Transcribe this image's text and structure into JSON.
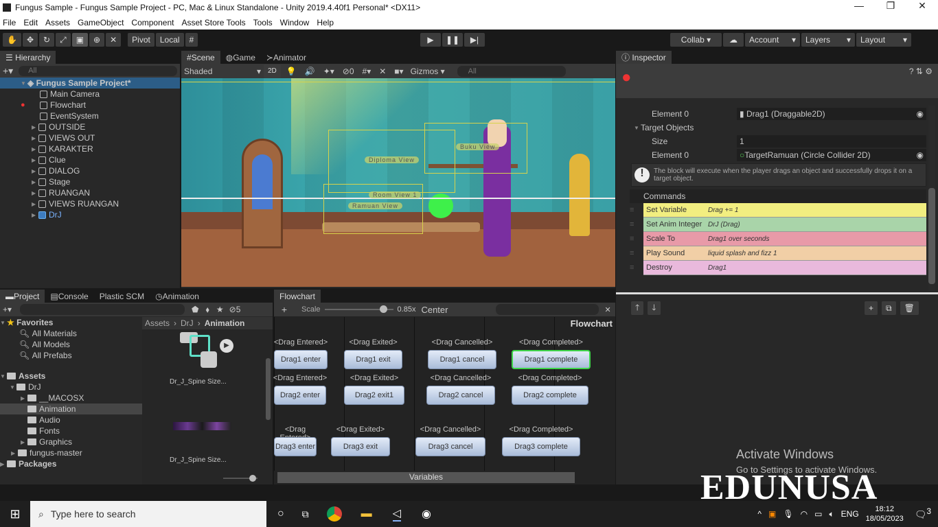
{
  "window": {
    "title": "Fungus Sample - Fungus Sample Project - PC, Mac & Linux Standalone - Unity 2019.4.40f1 Personal* <DX11>",
    "minimize": "—",
    "maximize": "❐",
    "close": "✕"
  },
  "menu": [
    "File",
    "Edit",
    "Assets",
    "GameObject",
    "Component",
    "Asset Store Tools",
    "Tools",
    "Window",
    "Help"
  ],
  "toolbar": {
    "pivot": "Pivot",
    "local": "Local",
    "collab": "Collab ▾",
    "account": "Account",
    "layers": "Layers",
    "layout": "Layout",
    "play": "▶",
    "pause": "❚❚",
    "step": "▶|"
  },
  "hierarchy": {
    "tab": "Hierarchy",
    "search_placeholder": "All",
    "root": "Fungus Sample Project*",
    "items": [
      "Main Camera",
      "Flowchart",
      "EventSystem",
      "OUTSIDE",
      "VIEWS OUT",
      "KARAKTER",
      "Clue",
      "DIALOG",
      "Stage",
      "RUANGAN",
      "VIEWS RUANGAN",
      "DrJ"
    ]
  },
  "scene": {
    "tabs": [
      "Scene",
      "Game",
      "Animator"
    ],
    "shading": "Shaded",
    "mode2d": "2D",
    "hidden_count": "0",
    "gizmos": "Gizmos",
    "search_placeholder": "All",
    "labels": [
      "Diploma View",
      "Buku View",
      "Room View 1",
      "Ramuan View"
    ]
  },
  "project": {
    "tabs": [
      "Project",
      "Console",
      "Plastic SCM",
      "Animation"
    ],
    "hidden_count": "5",
    "favorites": "Favorites",
    "fav_items": [
      "All Materials",
      "All Models",
      "All Prefabs"
    ],
    "assets": "Assets",
    "tree": [
      "DrJ",
      "__MACOSX",
      "Animation",
      "Audio",
      "Fonts",
      "Graphics",
      "fungus-master"
    ],
    "packages": "Packages",
    "breadcrumb": [
      "Assets",
      "DrJ",
      "Animation"
    ],
    "files": [
      "Dr_J_Spine Size...",
      "Dr_J_Spine Size..."
    ]
  },
  "flowchart": {
    "tab": "Flowchart",
    "scale_label": "Scale",
    "scale": "0.85x",
    "scale_value": 0.85,
    "center": "Center",
    "title": "Flowchart",
    "variables": "Variables",
    "events": [
      "<Drag Entered>",
      "<Drag Exited>",
      "<Drag Cancelled>",
      "<Drag Completed>"
    ],
    "blocks": [
      [
        "Drag1 enter",
        "Drag1 exit",
        "Drag1 cancel",
        "Drag1 complete"
      ],
      [
        "Drag2 enter",
        "Drag2 exit1",
        "Drag2 cancel",
        "Drag2 complete"
      ],
      [
        "Drag3 enter",
        "Drag3 exit",
        "Drag3 cancel",
        "Drag3 complete"
      ]
    ]
  },
  "inspector": {
    "tab": "Inspector",
    "element0_label": "Element 0",
    "element0_value": "Drag1 (Draggable2D)",
    "target_objects": "Target Objects",
    "size_label": "Size",
    "size_value": "1",
    "target_element_label": "Element 0",
    "target_element_value": "TargetRamuan (Circle Collider 2D)",
    "info": "The block will execute when the player drags an object and successfully drops it on a target object.",
    "commands_header": "Commands",
    "commands": [
      {
        "name": "Set Variable",
        "summary": "Drag += 1",
        "color": "#f2ee80"
      },
      {
        "name": "Set Anim Integer",
        "summary": "DrJ (Drag)",
        "color": "#a9d4a9"
      },
      {
        "name": "Scale To",
        "summary": "Drag1 over seconds",
        "color": "#e89aa8"
      },
      {
        "name": "Play Sound",
        "summary": "liquid splash and fizz 1",
        "color": "#f1cfa6"
      },
      {
        "name": "Destroy",
        "summary": "Drag1",
        "color": "#e9b9dc"
      }
    ]
  },
  "watermark": {
    "activate": "Activate Windows",
    "goto": "Go to Settings to activate Windows.",
    "brand": "EDUNUSA"
  },
  "taskbar": {
    "search_placeholder": "Type here to search",
    "lang": "ENG",
    "time": "18:12",
    "date": "18/05/2023",
    "notif": "3"
  }
}
